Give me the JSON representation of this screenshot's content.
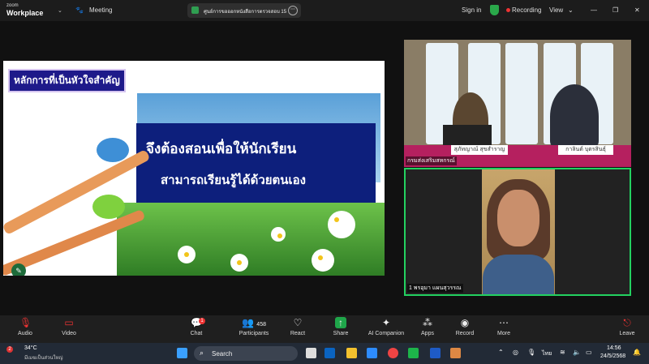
{
  "app": {
    "logo_line1": "zoom",
    "logo_line2": "Workplace",
    "meeting_label": "Meeting"
  },
  "title_pill": {
    "text": "ศูนย์การขอออกหนังสือการตรวจสอบ 15"
  },
  "header_right": {
    "sign_in": "Sign in",
    "recording": "Recording",
    "view": "View"
  },
  "slide": {
    "banner": "หลักการที่เป็นหัวใจสำคัญ",
    "line1": "จึงต้องสอนเพื่อให้นักเรียน",
    "line2": "สามารถเรียนรู้ได้ด้วยตนเอง"
  },
  "participants_panel": {
    "top_name": "กรมส่งเสริมสหกรณ์",
    "nameplate1": "สุภัทญาณ์ สุขสำราญ",
    "nameplate2": "กาลินต์ บุตรสินธุ์",
    "bottom_name": "1 พรอุมา แผนสุวรรณ"
  },
  "toolbar": {
    "audio": "Audio",
    "video": "Video",
    "chat": "Chat",
    "chat_badge": "1",
    "participants": "Participants",
    "participants_count": "458",
    "react": "React",
    "share": "Share",
    "ai": "AI Companion",
    "apps": "Apps",
    "record": "Record",
    "more": "More",
    "leave": "Leave"
  },
  "taskbar": {
    "weather_temp": "34°C",
    "weather_desc": "มีเมฆเป็นส่วนใหญ่",
    "weather_badge": "2",
    "search": "Search",
    "lang": "ไทย",
    "time": "14:56",
    "date": "24/5/2568"
  }
}
